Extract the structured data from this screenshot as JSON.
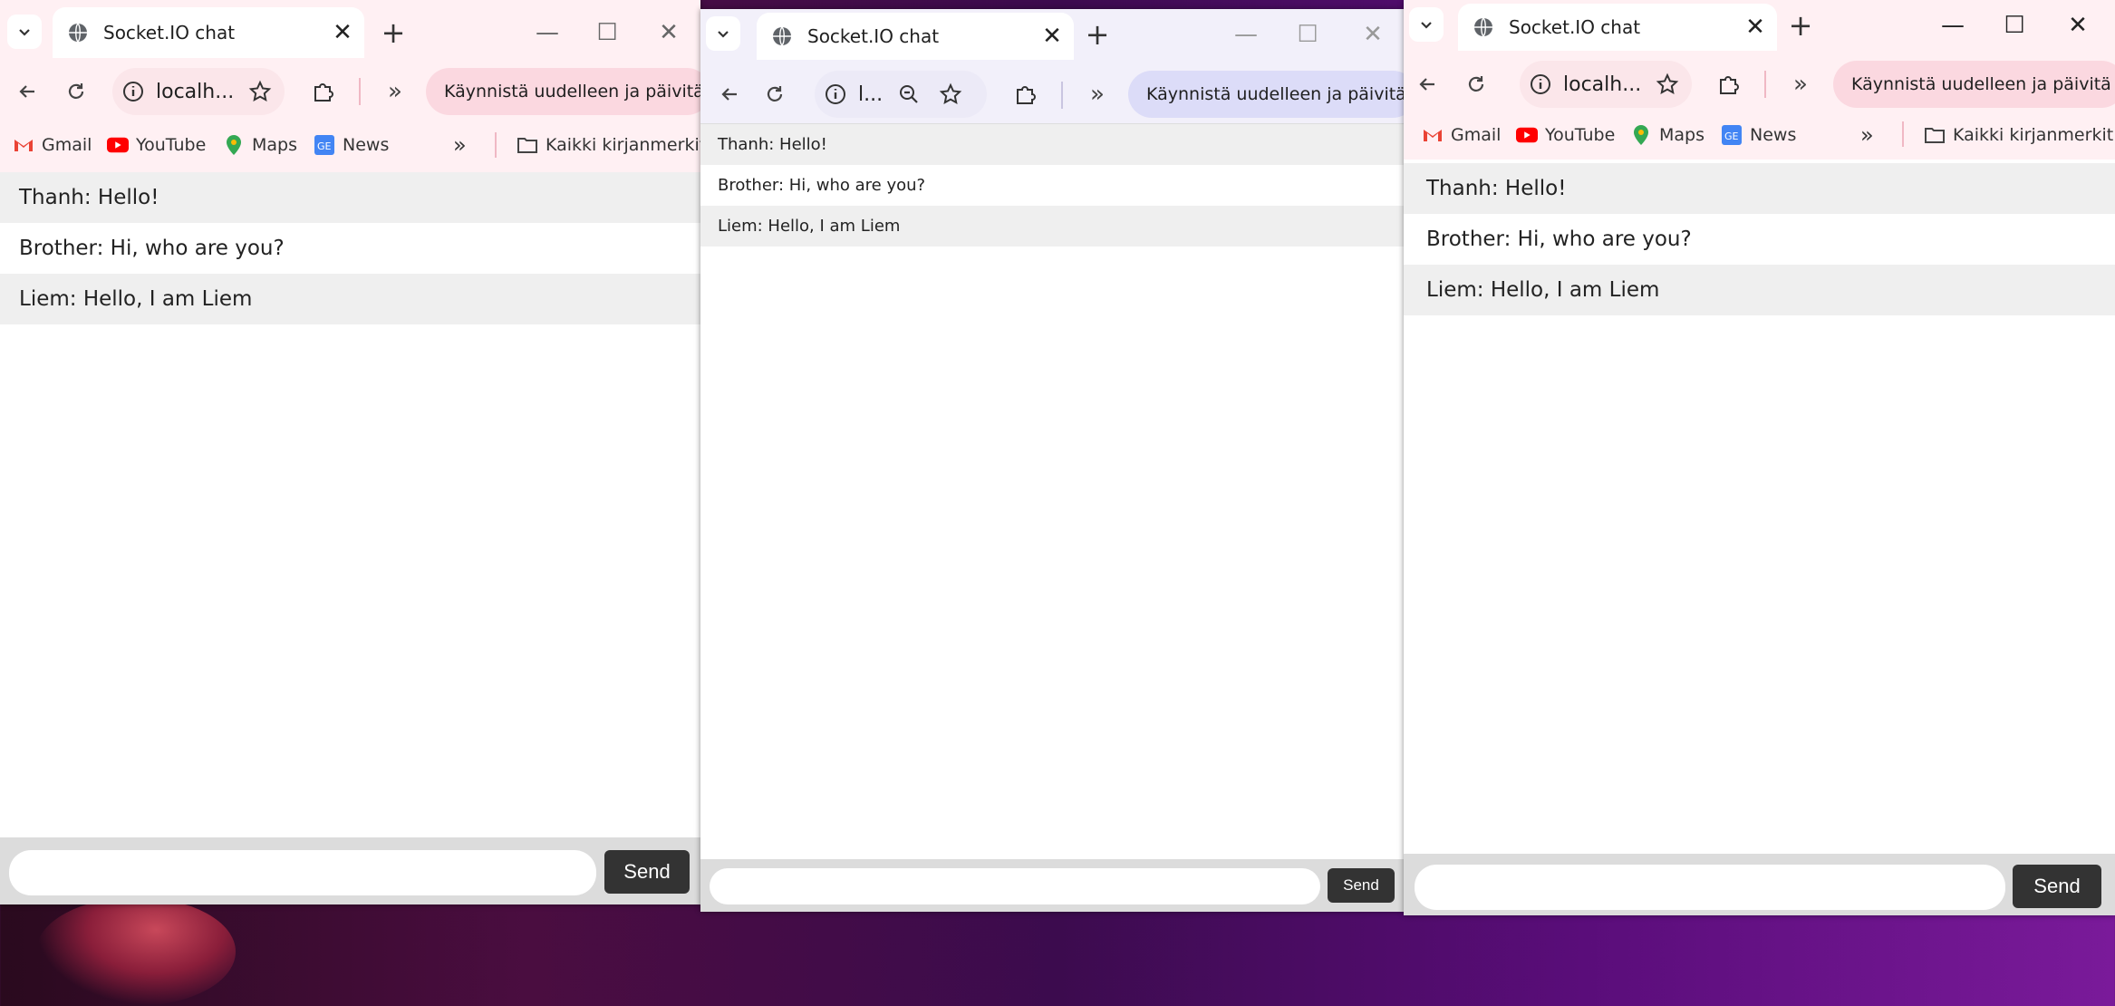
{
  "tab_title": "Socket.IO chat",
  "url_short": "localh...",
  "url_tiny": "l...",
  "relaunch_label": "Käynnistä uudelleen ja päivitä",
  "bookmarks": {
    "gmail": "Gmail",
    "youtube": "YouTube",
    "maps": "Maps",
    "news": "News",
    "all": "Kaikki kirjanmerkit"
  },
  "messages": [
    "Thanh: Hello!",
    "Brother: Hi, who are you?",
    "Liem: Hello, I am Liem"
  ],
  "input_value": "",
  "send_label": "Send",
  "colors": {
    "frame_pink": "#fff0f3",
    "frame_lavender": "#f2f0fa",
    "omnibox_pink": "#fbe6ea",
    "omnibox_lavender": "#eceaf7",
    "relaunch_pink": "#fbd8e0",
    "relaunch_lavender": "#dcdcf8",
    "send_bg": "#333333"
  }
}
